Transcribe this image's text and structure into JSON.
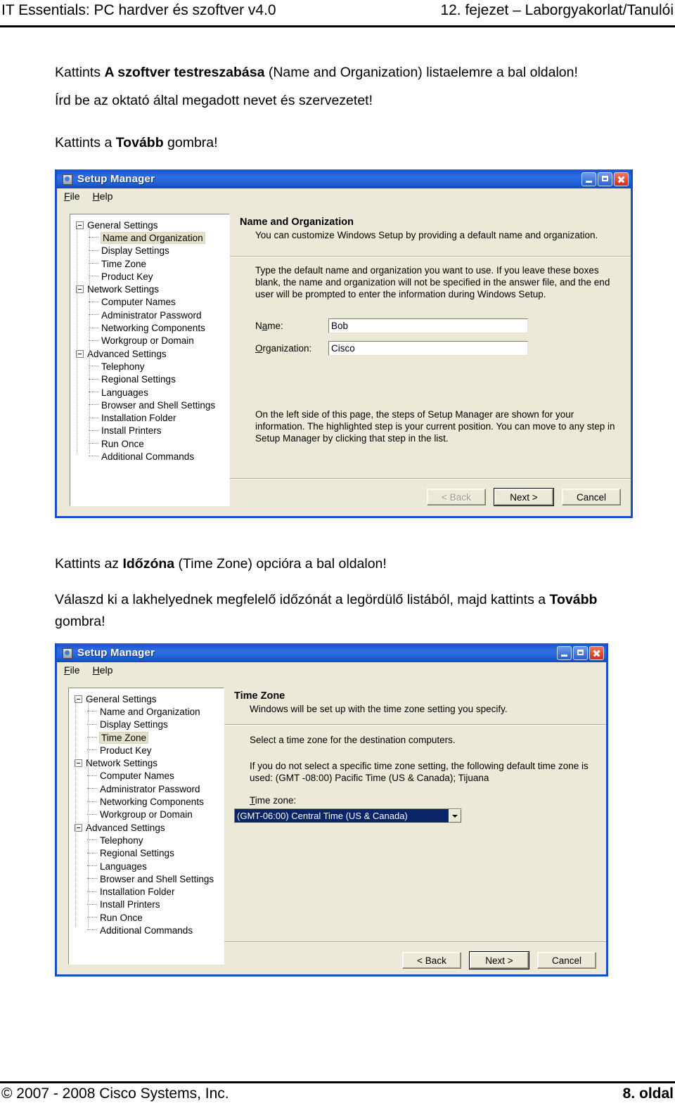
{
  "page": {
    "header_left": "IT Essentials: PC hardver és szoftver v4.0",
    "header_right": "12. fejezet – Laborgyakorlat/Tanulói",
    "footer_left": "© 2007 - 2008 Cisco Systems, Inc.",
    "footer_right": "8. oldal"
  },
  "instructions": {
    "step1_pre": "Kattints ",
    "step1_bold": "A szoftver testreszabása",
    "step1_post": " (Name and Organization) listaelemre a bal oldalon!",
    "step2": "Írd be az oktató által megadott nevet és szervezetet!",
    "step3_pre": "Kattints a ",
    "step3_bold": "Tovább",
    "step3_post": " gombra!",
    "step4_pre": "Kattints az ",
    "step4_bold": "Időzóna",
    "step4_post": " (Time Zone) opcióra a bal oldalon!",
    "step5_pre": "Válaszd ki a lakhelyednek megfelelő időzónát a legördülő listából, majd kattints a ",
    "step5_bold": "Tovább",
    "step5_post": " gombra!"
  },
  "window": {
    "title": "Setup Manager",
    "menu": {
      "file": "File",
      "help": "Help"
    },
    "controls": {
      "minimize": "minimize-icon",
      "maximize": "maximize-icon",
      "close": "close-icon"
    }
  },
  "tree": {
    "nodes": [
      {
        "label": "General Settings",
        "level": 1
      },
      {
        "label": "Name and Organization",
        "level": 2
      },
      {
        "label": "Display Settings",
        "level": 2
      },
      {
        "label": "Time Zone",
        "level": 2
      },
      {
        "label": "Product Key",
        "level": 2
      },
      {
        "label": "Network Settings",
        "level": 1
      },
      {
        "label": "Computer Names",
        "level": 2
      },
      {
        "label": "Administrator Password",
        "level": 2
      },
      {
        "label": "Networking Components",
        "level": 2
      },
      {
        "label": "Workgroup or Domain",
        "level": 2
      },
      {
        "label": "Advanced Settings",
        "level": 1
      },
      {
        "label": "Telephony",
        "level": 2
      },
      {
        "label": "Regional Settings",
        "level": 2
      },
      {
        "label": "Languages",
        "level": 2
      },
      {
        "label": "Browser and Shell Settings",
        "level": 2
      },
      {
        "label": "Installation Folder",
        "level": 2
      },
      {
        "label": "Install Printers",
        "level": 2
      },
      {
        "label": "Run Once",
        "level": 2
      },
      {
        "label": "Additional Commands",
        "level": 2
      }
    ]
  },
  "dialog1": {
    "selected_node": "Name and Organization",
    "heading": "Name and Organization",
    "subheading": "You can customize Windows Setup by providing a default name and organization.",
    "body_text": "Type the default name and organization you want to use. If you leave these boxes blank, the name and organization will not be specified in the answer file, and the end user will be prompted to enter the information during Windows Setup.",
    "name_label": "Name:",
    "name_value": "Bob",
    "org_label": "Organization:",
    "org_value": "Cisco",
    "footer_text": "On the left side of this page, the steps of Setup Manager are shown for your information. The highlighted step is your current position. You can move to any step in Setup Manager by clicking that step in the list.",
    "buttons": {
      "back": "< Back",
      "next": "Next >",
      "cancel": "Cancel",
      "back_disabled": true
    }
  },
  "dialog2": {
    "selected_node": "Time Zone",
    "heading": "Time Zone",
    "subheading": "Windows will be set up with the time zone setting you specify.",
    "body_text_1": "Select a time zone for the destination computers.",
    "body_text_2": "If you do not select a specific time zone setting, the following default time zone is used: (GMT -08:00) Pacific Time (US & Canada); Tijuana",
    "combo_label": "Time zone:",
    "combo_value": "(GMT-06:00) Central Time (US & Canada)",
    "buttons": {
      "back": "< Back",
      "next": "Next >",
      "cancel": "Cancel",
      "back_disabled": false
    }
  },
  "colors": {
    "title_blue": "#1550c8",
    "dialog_face": "#ece9d8",
    "selection_blue": "#0a246a",
    "tree_highlight": "#e4e0cc"
  }
}
